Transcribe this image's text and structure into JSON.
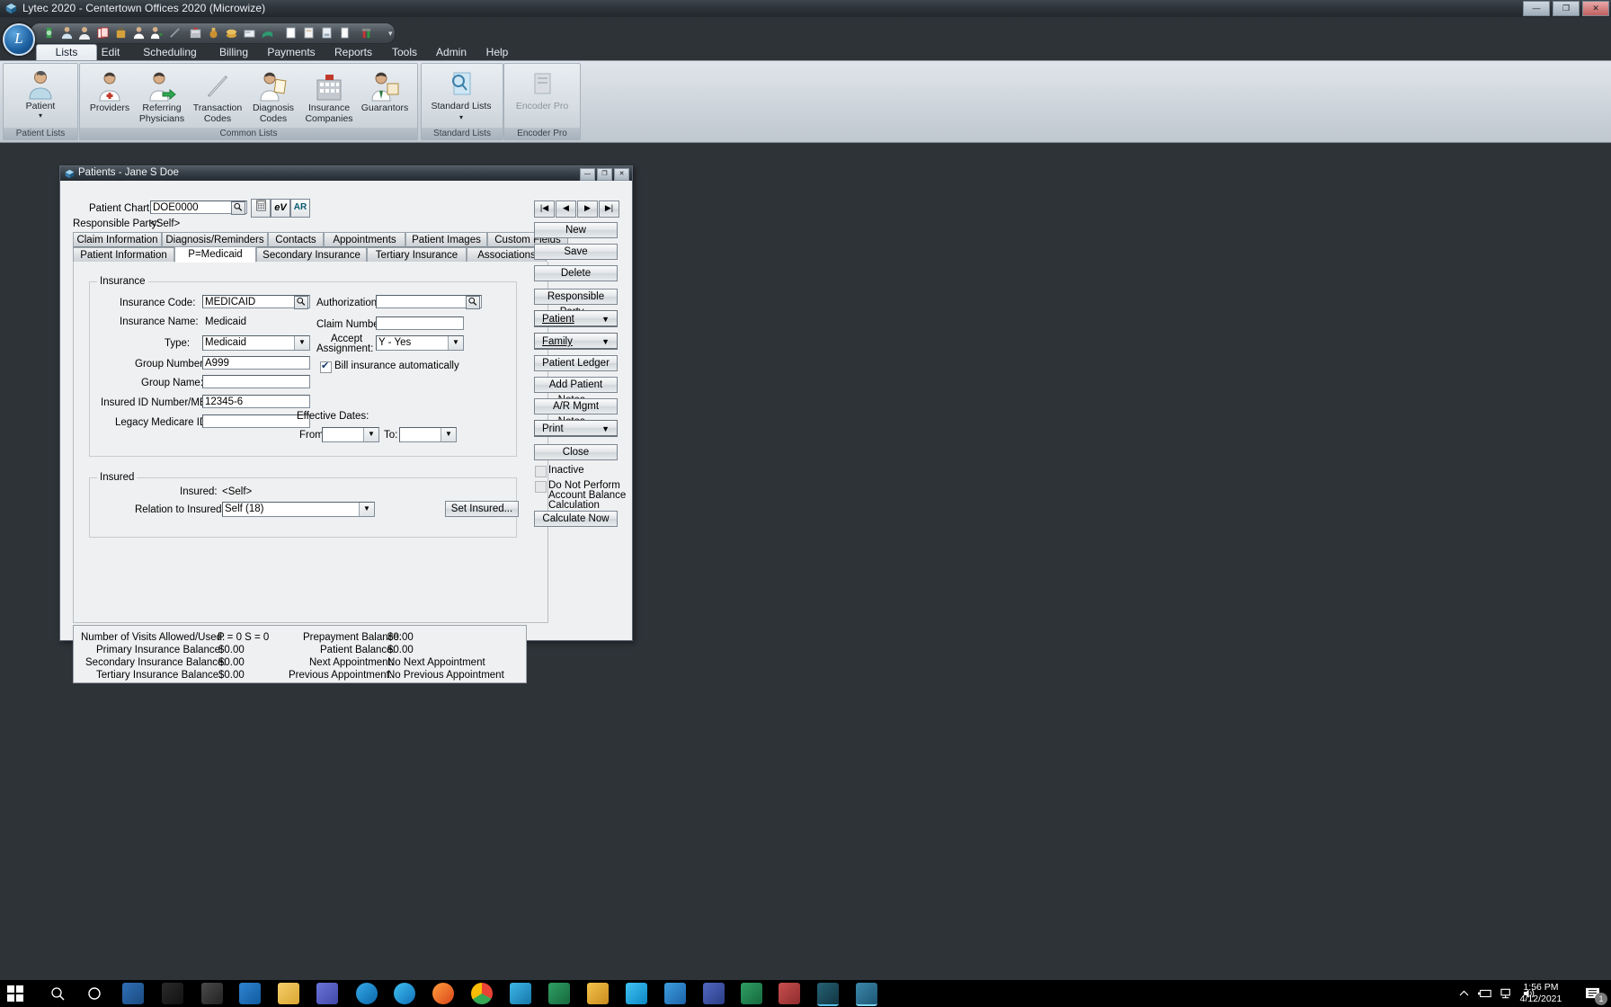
{
  "window": {
    "title": "Lytec 2020 - Centertown Offices 2020 (Microwize)",
    "icon": "lytec-cube-icon",
    "minimize": "—",
    "maximize": "❐",
    "close": "✕",
    "orb_letter": "L",
    "qat_overflow": "▾"
  },
  "ribbon": {
    "tabs": [
      {
        "label": "Lists",
        "active": true
      },
      {
        "label": "Edit",
        "active": false
      },
      {
        "label": "Scheduling",
        "active": false
      },
      {
        "label": "Billing",
        "active": false
      },
      {
        "label": "Payments",
        "active": false
      },
      {
        "label": "Reports",
        "active": false
      },
      {
        "label": "Tools",
        "active": false
      },
      {
        "label": "Admin",
        "active": false
      },
      {
        "label": "Help",
        "active": false
      }
    ],
    "groups": [
      {
        "name": "Patient Lists",
        "label": "Patient Lists",
        "items": [
          {
            "label": "Patient",
            "icon": "patient-icon",
            "caret": "▾"
          }
        ]
      },
      {
        "name": "Common Lists",
        "label": "Common Lists",
        "items": [
          {
            "label": "Providers",
            "icon": "provider-icon"
          },
          {
            "label": "Referring Physicians",
            "icon": "referring-physician-icon"
          },
          {
            "label": "Transaction Codes",
            "icon": "transaction-code-icon"
          },
          {
            "label": "Diagnosis Codes",
            "icon": "diagnosis-code-icon"
          },
          {
            "label": "Insurance Companies",
            "icon": "insurance-company-icon"
          },
          {
            "label": "Guarantors",
            "icon": "guarantor-icon"
          }
        ]
      },
      {
        "name": "Standard Lists",
        "label": "Standard Lists",
        "items": [
          {
            "label": "Standard Lists",
            "icon": "standard-lists-icon",
            "caret": "▾"
          }
        ]
      },
      {
        "name": "Encoder Pro",
        "label": "Encoder Pro",
        "items": [
          {
            "label": "Encoder Pro",
            "icon": "encoder-pro-icon",
            "disabled": true
          }
        ]
      }
    ]
  },
  "dialog": {
    "title": "Patients - Jane S Doe",
    "icon": "lytec-cube-icon",
    "minimize": "—",
    "restore": "❐",
    "close": "✕",
    "patient_chart_label": "Patient Chart:",
    "patient_chart_value": "DOE0000",
    "search_icon": "magnifier-icon",
    "toolbar_icons": [
      {
        "name": "calculator-icon",
        "glyph": "▦"
      },
      {
        "name": "eligibility-icon",
        "glyph": "eV"
      },
      {
        "name": "ar-icon",
        "glyph": "AR"
      }
    ],
    "responsible_party_label": "Responsible Party:",
    "responsible_party_value": "<Self>",
    "tabs_row1": [
      "Claim Information",
      "Diagnosis/Reminders",
      "Contacts",
      "Appointments",
      "Patient Images",
      "Custom Fields"
    ],
    "tabs_row2": [
      "Patient Information",
      "P=Medicaid",
      "Secondary Insurance",
      "Tertiary Insurance",
      "Associations"
    ],
    "selected_tab": "P=Medicaid",
    "insurance_group": {
      "title": "Insurance",
      "insurance_code_label": "Insurance Code:",
      "insurance_code_value": "MEDICAID",
      "insurance_name_label": "Insurance Name:",
      "insurance_name_value": "Medicaid",
      "type_label": "Type:",
      "type_value": "Medicaid",
      "group_number_label": "Group Number:",
      "group_number_value": "A999",
      "group_name_label": "Group Name:",
      "group_name_value": "",
      "insured_id_label": "Insured ID Number/MBI:",
      "insured_id_value": "12345-6",
      "legacy_medicare_label": "Legacy Medicare ID:",
      "legacy_medicare_value": "",
      "authorization_label": "Authorization:",
      "authorization_value": "",
      "claim_number_label": "Claim Number:",
      "claim_number_value": "",
      "accept_assignment_label_1": "Accept",
      "accept_assignment_label_2": "Assignment:",
      "accept_assignment_value": "Y - Yes",
      "bill_auto_label": "Bill insurance automatically",
      "bill_auto_checked": true,
      "effective_dates_label": "Effective Dates:",
      "from_label": "From:",
      "from_value": "",
      "to_label": "To:",
      "to_value": ""
    },
    "insured_group": {
      "title": "Insured",
      "insured_label": "Insured:",
      "insured_value": "<Self>",
      "relation_label": "Relation to Insured:",
      "relation_value": "Self (18)",
      "set_insured_button": "Set Insured..."
    },
    "stats": {
      "left": [
        {
          "label": "Number of Visits Allowed/Used:",
          "value": "P = 0   S = 0"
        },
        {
          "label": "Primary Insurance Balance:",
          "value": "$0.00"
        },
        {
          "label": "Secondary Insurance Balance:",
          "value": "$0.00"
        },
        {
          "label": "Tertiary Insurance Balance:",
          "value": "$0.00"
        }
      ],
      "right": [
        {
          "label": "Prepayment Balance:",
          "value": "$0.00"
        },
        {
          "label": "Patient Balance:",
          "value": "$0.00"
        },
        {
          "label": "Next Appointment:",
          "value": "No Next Appointment"
        },
        {
          "label": "Previous Appointment:",
          "value": "No Previous Appointment"
        }
      ]
    },
    "nav": [
      {
        "name": "first-record-button",
        "glyph": "|◀"
      },
      {
        "name": "previous-record-button",
        "glyph": "◀"
      },
      {
        "name": "next-record-button",
        "glyph": "▶"
      },
      {
        "name": "last-record-button",
        "glyph": "▶|"
      }
    ],
    "buttons": [
      {
        "name": "new-button",
        "label": "New"
      },
      {
        "name": "save-button",
        "label": "Save"
      },
      {
        "name": "delete-button",
        "label": "Delete"
      },
      {
        "name": "responsible-party-button",
        "label": "Responsible Party..."
      }
    ],
    "dropdowns": [
      {
        "name": "patient-dropdown",
        "label": "Patient",
        "caret": "▼"
      },
      {
        "name": "family-dropdown",
        "label": "Family",
        "caret": "▼"
      }
    ],
    "buttons2": [
      {
        "name": "patient-ledger-button",
        "label": "Patient Ledger"
      },
      {
        "name": "add-patient-notes-button",
        "label": "Add Patient Notes..."
      },
      {
        "name": "ar-mgmt-notes-button",
        "label": "A/R Mgmt Notes..."
      }
    ],
    "print_dropdown": {
      "label": "Print",
      "caret": "▼"
    },
    "close_button": "Close",
    "inactive_label": "Inactive",
    "inactive_checked": false,
    "do_not_perform_label_1": "Do Not Perform",
    "do_not_perform_label_2": "Account Balance",
    "do_not_perform_label_3": "Calculation",
    "do_not_perform_checked": false,
    "calculate_now_button": "Calculate Now"
  },
  "taskbar": {
    "start_icon": "windows-start-icon",
    "search_icon": "search-icon",
    "cortana_icon": "cortana-icon",
    "time": "1:56 PM",
    "date": "4/12/2021",
    "tray": {
      "chevron": "⌃",
      "battery_icon": "battery-icon",
      "network_icon": "network-icon",
      "volume_icon": "volume-icon",
      "notification_icon": "notification-icon",
      "notification_count": "1"
    },
    "apps": [
      {
        "name": "task-view-icon",
        "color": "#2b5797"
      },
      {
        "name": "terminal-icon",
        "color": "#1a1a1a"
      },
      {
        "name": "clock-app-icon",
        "color": "#3a3a3a"
      },
      {
        "name": "outlook-icon",
        "color": "#0f6cbd"
      },
      {
        "name": "file-explorer-icon",
        "color": "#f0c040"
      },
      {
        "name": "teams-icon",
        "color": "#5059c9"
      },
      {
        "name": "edge-legacy-icon",
        "color": "#0c7dbb"
      },
      {
        "name": "edge-icon",
        "color": "#1a8cd8"
      },
      {
        "name": "firefox-icon",
        "color": "#e86b1e"
      },
      {
        "name": "chrome-icon",
        "color": "#4285f4"
      },
      {
        "name": "kodi-icon",
        "color": "#29b6f6"
      },
      {
        "name": "excel-app-icon",
        "color": "#1d6f42"
      },
      {
        "name": "snagit-icon",
        "color": "#e8a33d"
      },
      {
        "name": "skype-icon",
        "color": "#00aff0"
      },
      {
        "name": "store-icon",
        "color": "#2b88d8"
      },
      {
        "name": "visio-icon",
        "color": "#3955a3"
      },
      {
        "name": "excel-icon",
        "color": "#1d6f42"
      },
      {
        "name": "access-icon",
        "color": "#a4373a"
      },
      {
        "name": "lytec-icon",
        "color": "#17505e"
      },
      {
        "name": "lytec-window-icon",
        "color": "#2e6f8e"
      }
    ]
  },
  "colors": {
    "desktop": "#0b6ea8",
    "window_chrome": "#2e3338",
    "ribbon": "#d4dbe1",
    "dialog_face": "#eff0f1",
    "accent": "#17386e"
  }
}
